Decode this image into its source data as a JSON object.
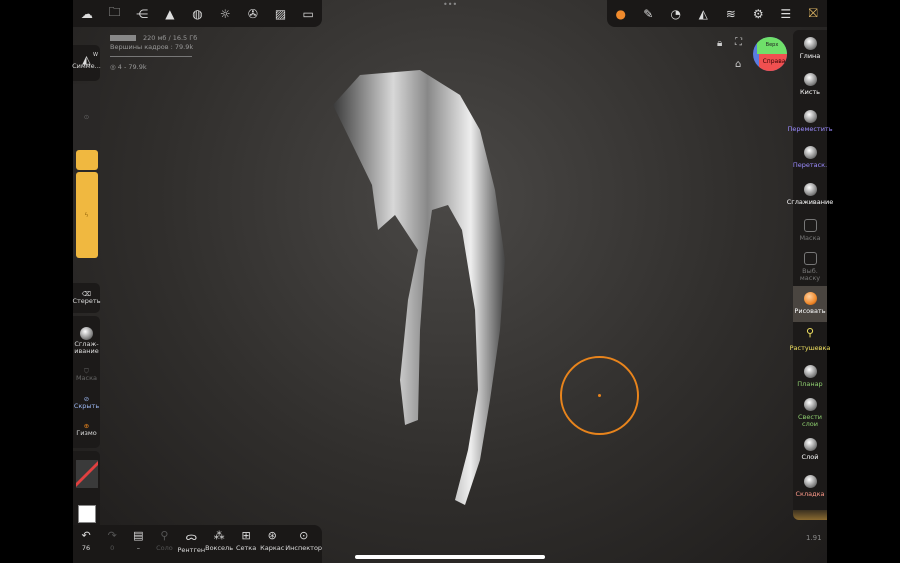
{
  "top_left_tools": [
    {
      "icon": "logo-icon",
      "g": "☁"
    },
    {
      "icon": "folder-icon",
      "g": "🗀"
    },
    {
      "icon": "share-nodes-icon",
      "g": "⋲"
    },
    {
      "icon": "mesh-icon",
      "g": "▲"
    },
    {
      "icon": "material-sphere-icon",
      "g": "◍"
    },
    {
      "icon": "light-icon",
      "g": "☼"
    },
    {
      "icon": "render-icon",
      "g": "✇"
    },
    {
      "icon": "image-icon",
      "g": "▨"
    },
    {
      "icon": "camera-icon",
      "g": "▭"
    }
  ],
  "top_right_tools": [
    {
      "icon": "paint-color-icon",
      "g": "●"
    },
    {
      "icon": "pencil-icon",
      "g": "✎"
    },
    {
      "icon": "palette-icon",
      "g": "◔"
    },
    {
      "icon": "symmetry-icon",
      "g": "◭"
    },
    {
      "icon": "layers-icon",
      "g": "≋"
    },
    {
      "icon": "settings-icon",
      "g": "⚙"
    },
    {
      "icon": "sliders-icon",
      "g": "☰"
    },
    {
      "icon": "gift-icon",
      "g": "⛝"
    }
  ],
  "info": {
    "memory": "220 мб / 16.5 Гб",
    "vertices": "Вершины кадров : 79.9k",
    "objects": "4 - 79.9k"
  },
  "menu_dots": "•••",
  "gizmo": {
    "top": "Верх",
    "front": "Справа"
  },
  "left_panel": {
    "symmetry": "Симме...",
    "symmetry_key": "W",
    "erase": "Стереть",
    "smooth": "Сглаж­ивание",
    "mask": "Маска",
    "hide": "Скрыть",
    "gizmo": "Гизмо"
  },
  "right_tools": [
    {
      "label": "Глина",
      "color": "#ffffff"
    },
    {
      "label": "Кисть",
      "color": "#ffffff"
    },
    {
      "label": "Переместить",
      "color": "#9b8cff"
    },
    {
      "label": "Перетаск.",
      "color": "#9b8cff"
    },
    {
      "label": "Сглаживание",
      "color": "#ffffff"
    },
    {
      "label": "Маска",
      "color": "#777777"
    },
    {
      "label": "Выб. маску",
      "color": "#777777"
    },
    {
      "label": "Рисовать",
      "color": "#ffffff"
    },
    {
      "label": "Растушевка",
      "color": "#f0e060"
    },
    {
      "label": "Планар",
      "color": "#8fd070"
    },
    {
      "label": "Свести слои",
      "color": "#8fd070"
    },
    {
      "label": "Слой",
      "color": "#ffffff"
    },
    {
      "label": "Складка",
      "color": "#ff9a8a"
    }
  ],
  "bottom": {
    "undo": "76",
    "redo": "0",
    "solo": "Соло",
    "xray": "Рентген",
    "voxel": "Воксель",
    "grid": "Сетка",
    "wireframe": "Каркас",
    "inspector": "Инспектор"
  },
  "version": "1.91",
  "colors": {
    "accent": "#f0b840",
    "brush_ring": "#e8841c"
  }
}
